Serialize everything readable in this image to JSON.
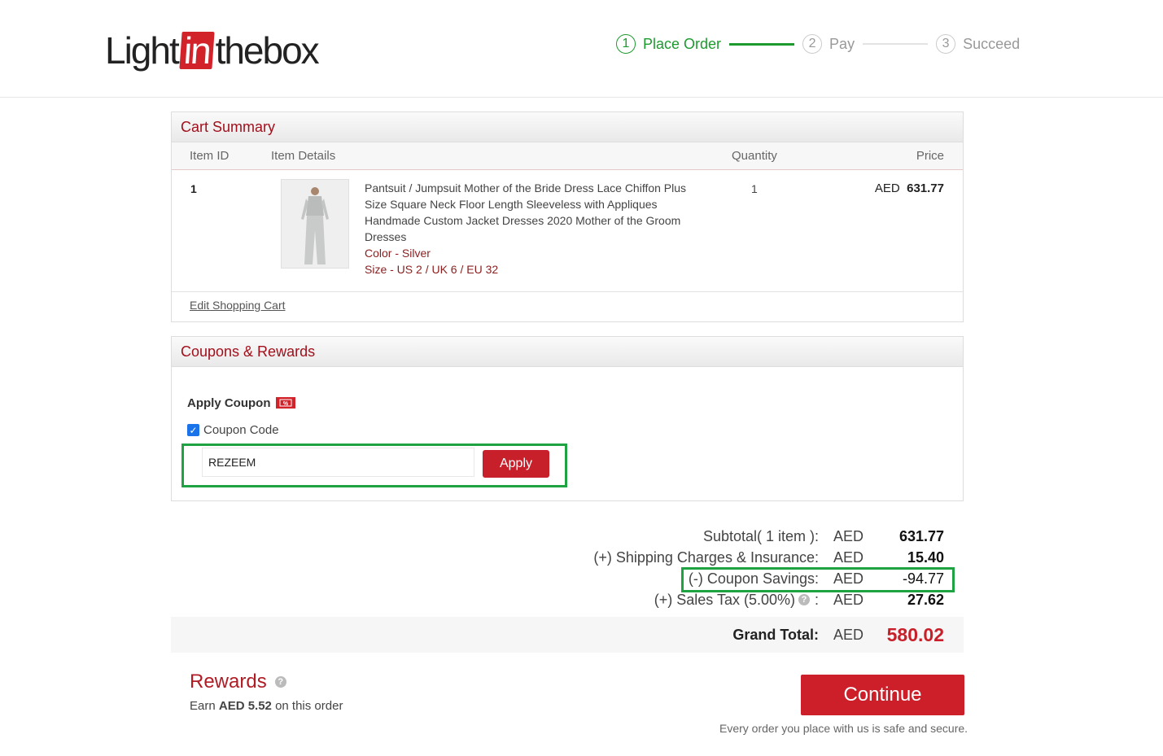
{
  "brand": {
    "pre": "Light",
    "mid": "in",
    "post": "thebox"
  },
  "steps": [
    {
      "num": "1",
      "label": "Place Order"
    },
    {
      "num": "2",
      "label": "Pay"
    },
    {
      "num": "3",
      "label": "Succeed"
    }
  ],
  "cart": {
    "title": "Cart Summary",
    "columns": {
      "id": "Item ID",
      "details": "Item Details",
      "qty": "Quantity",
      "price": "Price"
    },
    "item": {
      "id": "1",
      "description": "Pantsuit / Jumpsuit Mother of the Bride Dress Lace Chiffon Plus Size Square Neck Floor Length Sleeveless with Appliques Handmade Custom Jacket Dresses 2020 Mother of the Groom Dresses",
      "color": "Color - Silver",
      "size": "Size - US 2 / UK 6 / EU 32",
      "qty": "1",
      "currency": "AED",
      "price": "631.77"
    },
    "edit_link": "Edit Shopping Cart"
  },
  "coupons": {
    "title": "Coupons & Rewards",
    "apply_label": "Apply Coupon",
    "checkbox_label": "Coupon Code",
    "code_value": "REZEEM",
    "apply_button": "Apply"
  },
  "summary": {
    "subtotal": {
      "label": "Subtotal( 1 item ):",
      "cur": "AED",
      "val": "631.77"
    },
    "shipping": {
      "label": "(+) Shipping Charges & Insurance:",
      "cur": "AED",
      "val": "15.40"
    },
    "coupon": {
      "label": "(-) Coupon Savings:",
      "cur": "AED",
      "val": "-94.77"
    },
    "tax": {
      "label": "(+) Sales Tax (5.00%)",
      "suffix": ":",
      "cur": "AED",
      "val": "27.62"
    },
    "grand": {
      "label": "Grand Total:",
      "cur": "AED",
      "val": "580.02"
    }
  },
  "rewards": {
    "title": "Rewards",
    "earn_pre": "Earn ",
    "earn_amount": "AED 5.52",
    "earn_post": " on this order"
  },
  "continue_button": "Continue",
  "secure_note": "Every order you place with us is safe and secure.",
  "colors": {
    "accent_red": "#cc1f29",
    "step_green": "#1d9a2e",
    "highlight_green": "#1fa342"
  }
}
